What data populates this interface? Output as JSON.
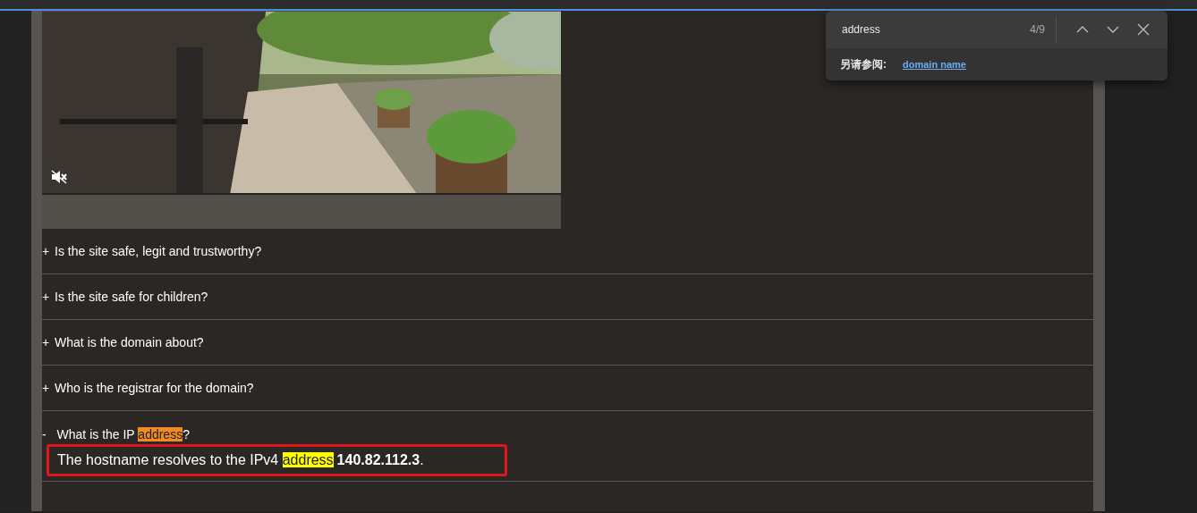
{
  "video": {
    "kind": "picture",
    "muted": true
  },
  "faq": [
    {
      "expanded": false,
      "toggle": "+",
      "question": [
        {
          "text": "Is the site safe, legit and trustworthy?"
        }
      ]
    },
    {
      "expanded": false,
      "toggle": "+",
      "question": [
        {
          "text": "Is the site safe for children?"
        }
      ]
    },
    {
      "expanded": false,
      "toggle": "+",
      "question": [
        {
          "text": "What is the domain about?"
        }
      ]
    },
    {
      "expanded": false,
      "toggle": "+",
      "question": [
        {
          "text": "Who is the registrar for the domain?"
        }
      ]
    },
    {
      "expanded": true,
      "toggle": "-",
      "question": [
        {
          "text": "What is the IP "
        },
        {
          "text": "address",
          "highlight": true,
          "current": true
        },
        {
          "text": "?"
        }
      ],
      "answer": [
        {
          "text": "The hostname resolves to the IPv4 "
        },
        {
          "text": "address",
          "highlight": true,
          "current": false
        },
        {
          "text": "140.82.112.3",
          "bold": true
        },
        {
          "text": "."
        }
      ],
      "annotated": true
    }
  ],
  "find_bar": {
    "query": "address",
    "count": "4/9",
    "see_also_label": "另请参阅:",
    "see_also_link": "domain name"
  }
}
